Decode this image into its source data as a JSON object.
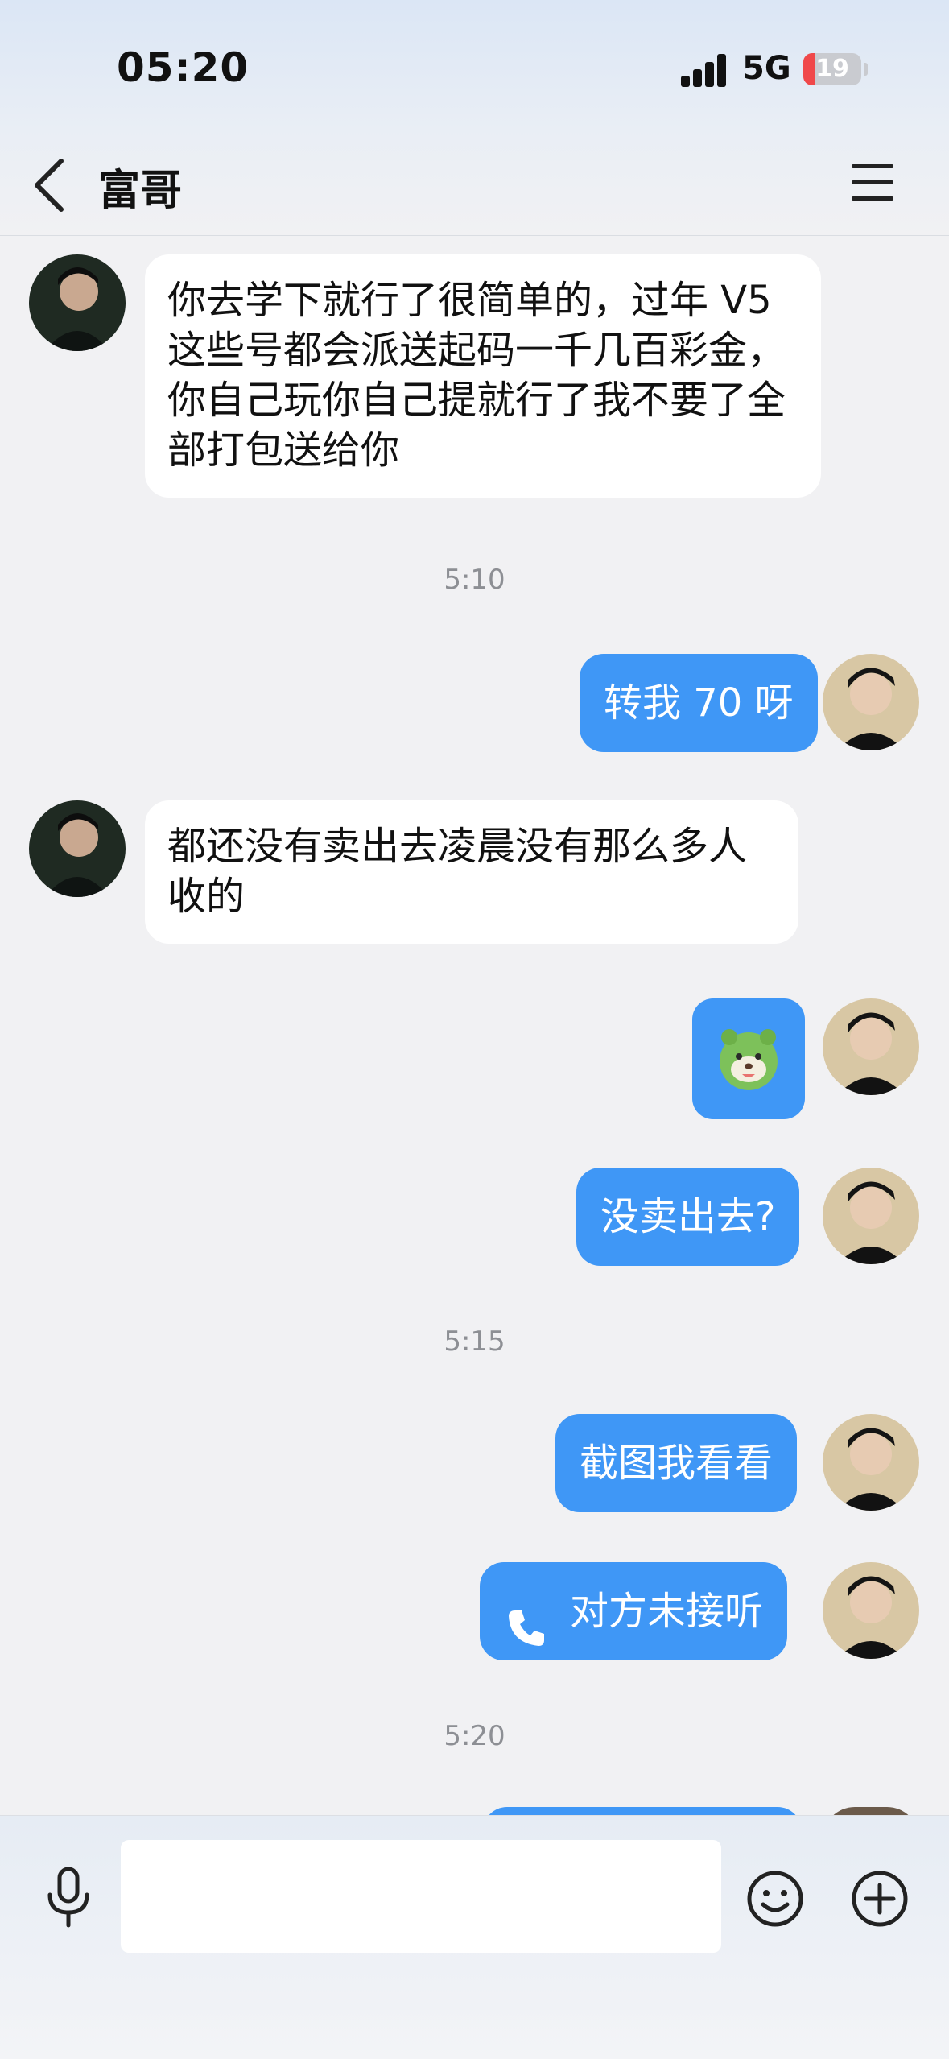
{
  "status_bar": {
    "time": "05:20",
    "network": "5G",
    "battery_level": "19",
    "battery_fraction": 0.19,
    "battery_color": "#f0484a"
  },
  "header": {
    "title": "富哥",
    "back_icon": "chevron-left-icon",
    "menu_icon": "menu-icon"
  },
  "messages": {
    "m1": {
      "direction": "incoming",
      "text": "你去学下就行了很简单的，过年 V5 这些号都会派送起码一千几百彩金，你自己玩你自己提就行了我不要了全部打包送给你"
    },
    "t1": "5:10",
    "m2": {
      "direction": "outgoing",
      "text": "转我 70 呀"
    },
    "m3": {
      "direction": "incoming",
      "text": "都还没有卖出去凌晨没有那么多人收的"
    },
    "m4": {
      "direction": "outgoing",
      "type": "sticker",
      "sticker_icon": "green-dog-sticker-icon"
    },
    "m5": {
      "direction": "outgoing",
      "text": "没卖出去?"
    },
    "t2": "5:15",
    "m6": {
      "direction": "outgoing",
      "text": "截图我看看"
    },
    "m7": {
      "direction": "outgoing",
      "type": "call",
      "icon": "phone-icon",
      "text": "对方未接听"
    },
    "t3": "5:20"
  },
  "input_bar": {
    "mic_icon": "microphone-icon",
    "placeholder": "",
    "emoji_icon": "smiley-icon",
    "plus_icon": "plus-circle-icon"
  },
  "colors": {
    "outgoing_bubble": "#3f97f6",
    "incoming_bubble": "#ffffff",
    "background": "#f1f1f3"
  }
}
